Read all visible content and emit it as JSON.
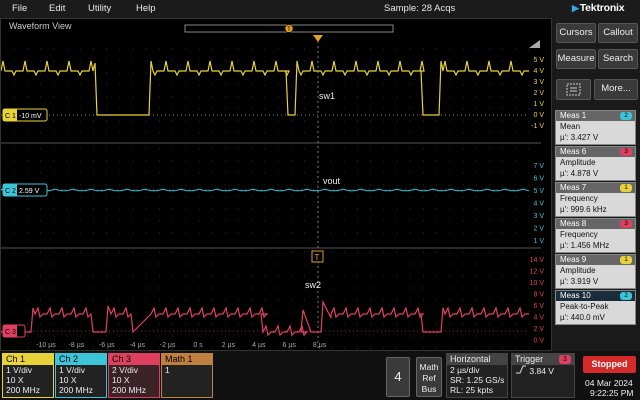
{
  "menu": {
    "file": "File",
    "edit": "Edit",
    "utility": "Utility",
    "help": "Help"
  },
  "status": {
    "sample": "Sample: 28 Acqs"
  },
  "brand": "Tektronix",
  "waveform_view": {
    "title": "Waveform View"
  },
  "traces": {
    "ch1": {
      "badge": "C 1",
      "offset": "-10 mV",
      "name": "sw1",
      "color": "#e8d23a"
    },
    "ch2": {
      "badge": "C 2",
      "offset": "2.59 V",
      "name": "vout",
      "color": "#3cc4d8"
    },
    "ch3": {
      "badge": "C 3",
      "name": "sw2",
      "color": "#e04060"
    }
  },
  "scales": {
    "ch1": [
      "5 V",
      "4 V",
      "3 V",
      "2 V",
      "1 V",
      "0 V",
      "-1 V"
    ],
    "ch2": [
      "7 V",
      "6 V",
      "5 V",
      "4 V",
      "3 V",
      "2 V",
      "1 V"
    ],
    "ch3": [
      "14 V",
      "12 V",
      "10 V",
      "8 V",
      "6 V",
      "4 V",
      "2 V",
      "0 V"
    ]
  },
  "time_axis": [
    "-10 µs",
    "-8 µs",
    "-6 µs",
    "-4 µs",
    "-2 µs",
    "0 s",
    "2 µs",
    "4 µs",
    "6 µs",
    "8 µs"
  ],
  "trigger_marker": "T",
  "right_panel": {
    "buttons": {
      "cursors": "Cursors",
      "callout": "Callout",
      "measure": "Measure",
      "search": "Search",
      "more": "More..."
    },
    "measurements": [
      {
        "title": "Meas 1",
        "badge": "2",
        "badge_color": "#3cc4d8",
        "name": "Mean",
        "value": "µ': 3.427 V"
      },
      {
        "title": "Meas 6",
        "badge": "3",
        "badge_color": "#e04060",
        "name": "Amplitude",
        "value": "µ': 4.878 V"
      },
      {
        "title": "Meas 7",
        "badge": "1",
        "badge_color": "#e8d23a",
        "name": "Frequency",
        "value": "µ': 999.6 kHz"
      },
      {
        "title": "Meas 8",
        "badge": "3",
        "badge_color": "#e04060",
        "name": "Frequency",
        "value": "µ': 1.456 MHz"
      },
      {
        "title": "Meas 9",
        "badge": "1",
        "badge_color": "#e8d23a",
        "name": "Amplitude",
        "value": "µ': 3.919 V"
      },
      {
        "title": "Meas 10",
        "badge": "2",
        "badge_color": "#3cc4d8",
        "name": "Peak-to-Peak",
        "value": "µ': 440.0 mV"
      }
    ]
  },
  "channels": [
    {
      "name": "Ch 1",
      "color": "#e8d23a",
      "lines": [
        "1 V/div",
        "10 X",
        "200 MHz"
      ]
    },
    {
      "name": "Ch 2",
      "color": "#3cc4d8",
      "lines": [
        "1 V/div",
        "10 X",
        "200 MHz"
      ]
    },
    {
      "name": "Ch 3",
      "color": "#e04060",
      "lines": [
        "2 V/div",
        "10 X",
        "200 MHz"
      ]
    },
    {
      "name": "Math 1",
      "color": "#c08040",
      "lines": [
        "1",
        "",
        ""
      ]
    }
  ],
  "bottom": {
    "four": "4",
    "math_ref_bus": [
      "Math",
      "Ref",
      "Bus"
    ],
    "horizontal": {
      "title": "Horizontal",
      "lines": [
        "2 µs/div",
        "SR: 1.25 GS/s",
        "RL: 25 kpts"
      ]
    },
    "trigger": {
      "title": "Trigger",
      "badge": "3",
      "level": "3.84 V"
    },
    "stopped": "Stopped",
    "date": "04 Mar 2024",
    "time": "9:22:25 PM"
  }
}
